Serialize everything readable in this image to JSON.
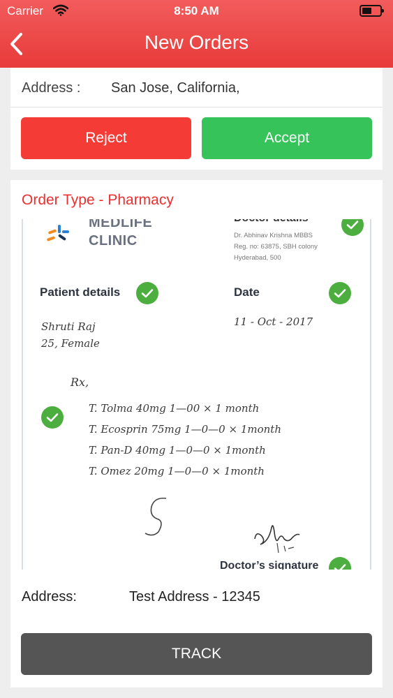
{
  "status_bar": {
    "carrier": "Carrier",
    "time": "8:50 AM"
  },
  "navbar": {
    "title": "New Orders",
    "back_icon": "chevron-left-icon"
  },
  "order_summary": {
    "address_label": "Address :",
    "address_value": "San Jose, California,",
    "reject_label": "Reject",
    "accept_label": "Accept"
  },
  "order_details": {
    "order_type": "Order Type - Pharmacy",
    "prescription": {
      "clinic_name_line1": "MEDLIFE",
      "clinic_name_line2": "CLINIC",
      "doctor_details_title": "Doctor details",
      "doctor_info": [
        "Dr. Abhinav Krishna MBBS",
        "Reg. no: 63875, SBH colony",
        "Hyderabad, 500"
      ],
      "patient_details_label": "Patient details",
      "date_label": "Date",
      "patient_name": "Shruti Raj",
      "patient_age_gender": "25, Female",
      "date_value": "11 - Oct - 2017",
      "rx_symbol": "Rx,",
      "medicines": [
        "T. Tolma 40mg  1—00 × 1 month",
        "T. Ecosprin 75mg  1—0—0 × 1month",
        "T. Pan-D 40mg  1—0—0 × 1month",
        "T. Omez 20mg  1—0—0 × 1month"
      ],
      "signature_label": "Doctor’s signature"
    },
    "address_label": "Address:",
    "address_value": "Test Address - 12345",
    "track_label": "TRACK"
  },
  "colors": {
    "navbar": "#ee4444",
    "reject": "#f43b36",
    "accept": "#35c35a",
    "track": "#555555",
    "order_type": "#ec3030",
    "check": "#4cae3f"
  }
}
